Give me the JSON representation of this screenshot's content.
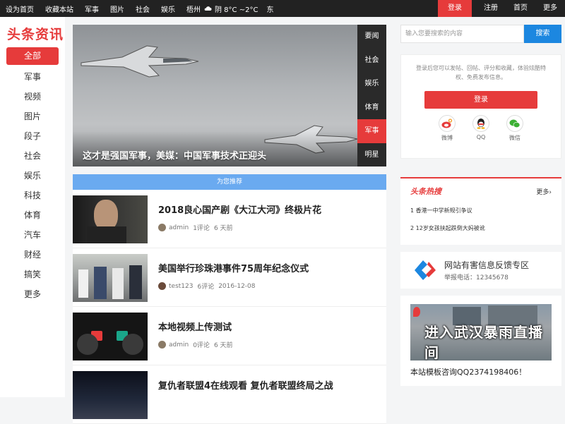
{
  "topbar": {
    "left_links": [
      "设为首页",
      "收藏本站",
      "军事",
      "图片",
      "社会",
      "娱乐"
    ],
    "city": "梧州",
    "weather": "阴 8°C ~2°C",
    "wind": "东",
    "login": "登录",
    "register": "注册",
    "home": "首页",
    "more": "更多"
  },
  "sidebar": {
    "logo": "头条资讯",
    "items": [
      "全部",
      "军事",
      "视频",
      "图片",
      "段子",
      "社会",
      "娱乐",
      "科技",
      "体育",
      "汽车",
      "财经",
      "搞笑",
      "更多"
    ]
  },
  "slider": {
    "caption": "这才是强国军事，美媒：中国军事技术正迎头",
    "tabs": [
      "要闻",
      "社会",
      "娱乐",
      "体育",
      "军事",
      "明星"
    ],
    "active_tab": "军事"
  },
  "recommend_label": "为您推荐",
  "news": [
    {
      "title": "2018良心国产剧《大江大河》终极片花",
      "author": "admin",
      "comments": "1评论",
      "time": "6 天前"
    },
    {
      "title": "美国举行珍珠港事件75周年纪念仪式",
      "author": "test123",
      "comments": "6评论",
      "time": "2016-12-08"
    },
    {
      "title": "本地视频上传测试",
      "author": "admin",
      "comments": "0评论",
      "time": "6 天前"
    },
    {
      "title": "复仇者联盟4在线观看 复仇者联盟终局之战",
      "author": "",
      "comments": "",
      "time": ""
    }
  ],
  "search": {
    "placeholder": "输入您要搜索的内容",
    "button": "搜索"
  },
  "login_box": {
    "tip": "登录后您可以发帖、回帖、评分和收藏，体验炫酷特权、免费发布信息。",
    "button": "登录",
    "social": [
      "微博",
      "QQ",
      "微信"
    ]
  },
  "hot": {
    "title": "头条热搜",
    "more": "更多›",
    "items": [
      "1 香港一中学新规引争议",
      "2 12岁女孩扶起跌倒大妈被讹"
    ]
  },
  "report": {
    "title": "网站有害信息反馈专区",
    "phone": "举报电话：12345678"
  },
  "ad": {
    "banner": "进入武汉暴雨直播间",
    "text": "本站模板咨询QQ2374198406！"
  },
  "colors": {
    "accent": "#e63b3b",
    "blue": "#1c87e0",
    "recommend": "#6aaaf0"
  }
}
